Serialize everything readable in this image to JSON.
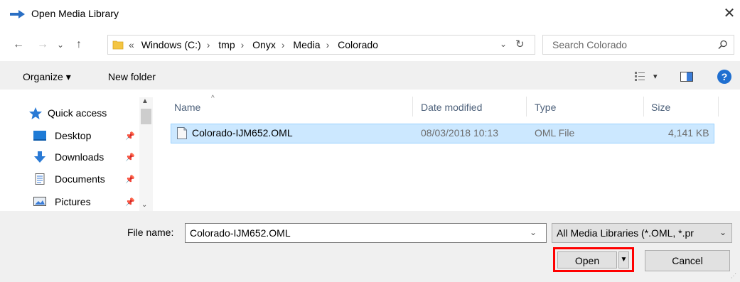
{
  "window": {
    "title": "Open Media Library",
    "close_glyph": "✕",
    "icon": "blue-arrow-icon"
  },
  "nav": {
    "back": "←",
    "forward": "→",
    "recent": "⌄",
    "up": "↑"
  },
  "address": {
    "overflow": "«",
    "crumbs": [
      "Windows (C:)",
      "tmp",
      "Onyx",
      "Media",
      "Colorado"
    ],
    "separator": "›",
    "dropdown": "⌄",
    "refresh": "↻"
  },
  "search": {
    "placeholder": "Search Colorado"
  },
  "toolbar": {
    "organize_label": "Organize ▾",
    "new_folder_label": "New folder",
    "view_dropdown": "▾",
    "help_label": "?"
  },
  "sidebar": {
    "items": [
      {
        "label": "Quick access",
        "icon": "star-icon",
        "pinned": false
      },
      {
        "label": "Desktop",
        "icon": "desktop-icon",
        "pinned": true
      },
      {
        "label": "Downloads",
        "icon": "download-arrow-icon",
        "pinned": true
      },
      {
        "label": "Documents",
        "icon": "document-icon",
        "pinned": true
      },
      {
        "label": "Pictures",
        "icon": "pictures-icon",
        "pinned": true
      }
    ],
    "pin_glyph": "📌",
    "scroll_up": "▲",
    "scroll_down": "⌄"
  },
  "file_list": {
    "columns": [
      "Name",
      "Date modified",
      "Type",
      "Size"
    ],
    "sort_indicator": "^",
    "rows": [
      {
        "name": "Colorado-IJM652.OML",
        "date": "08/03/2018 10:13",
        "type": "OML File",
        "size": "4,141 KB",
        "selected": true
      }
    ]
  },
  "footer": {
    "file_name_label": "File name:",
    "file_name_value": "Colorado-IJM652.OML",
    "file_name_dropdown": "⌄",
    "filter_value": "All Media Libraries (*.OML, *.pr",
    "filter_dropdown": "⌄",
    "open_label": "Open",
    "open_split": "▼",
    "cancel_label": "Cancel",
    "highlight_color": "#ff0000"
  },
  "colors": {
    "selection_fill": "#cce8ff",
    "selection_border": "#99d1ff",
    "panel_gray": "#f0f0f0",
    "header_text": "#4c607a",
    "help_blue": "#1f6fd0"
  }
}
